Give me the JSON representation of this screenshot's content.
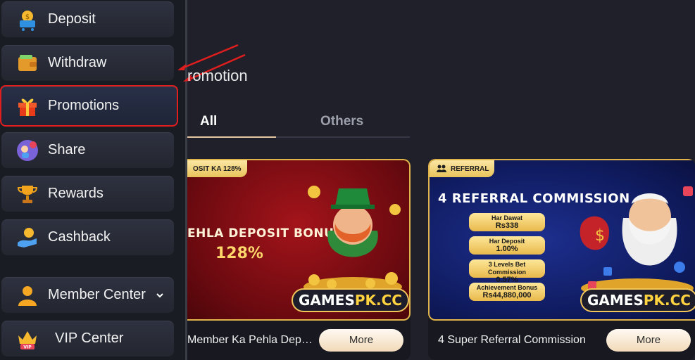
{
  "sidebar": {
    "items": [
      {
        "label": "Deposit",
        "icon": "wallet-cart-icon"
      },
      {
        "label": "Withdraw",
        "icon": "wallet-icon"
      },
      {
        "label": "Promotions",
        "icon": "gift-icon",
        "selected": true
      },
      {
        "label": "Share",
        "icon": "share-icon"
      },
      {
        "label": "Rewards",
        "icon": "trophy-icon"
      },
      {
        "label": "Cashback",
        "icon": "cashback-icon"
      },
      {
        "label": "Member Center",
        "icon": "user-icon",
        "expandable": true
      },
      {
        "label": "VIP Center",
        "icon": "crown-vip-icon"
      }
    ]
  },
  "main": {
    "page_title": "romotion",
    "tabs": [
      {
        "label": "All",
        "active": true
      },
      {
        "label": "Others",
        "active": false
      }
    ],
    "cards": [
      {
        "ribbon": "OSIT KA 128%",
        "banner_title": "EHLA DEPOSIT BONUS",
        "banner_value": "128%",
        "brand_main": "GAMES",
        "brand_accent": "PK.CC",
        "footer_text": "Member Ka Pehla Depo…",
        "button": "More"
      },
      {
        "ribbon": "REFERRAL",
        "banner_title": "4 REFERRAL COMMISSION",
        "pills": [
          {
            "label": "Har Dawat",
            "value": "Rs338"
          },
          {
            "label": "Har Deposit",
            "value": "1.00%"
          },
          {
            "label": "3 Levels Bet Commission",
            "value": "0.57%"
          },
          {
            "label": "Achievement Bonus",
            "value": "Rs44,880,000"
          }
        ],
        "brand_main": "GAMES",
        "brand_accent": "PK.CC",
        "footer_text": "4 Super Referral Commission",
        "button": "More"
      }
    ]
  },
  "colors": {
    "background": "#1f2029",
    "highlight_border": "#e01e1e",
    "accent_gold": "#e6c7a2",
    "tab_inactive": "#9da0ab"
  }
}
